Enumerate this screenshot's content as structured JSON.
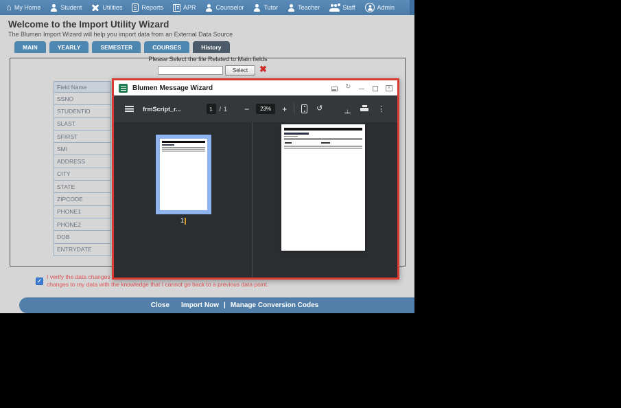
{
  "nav": {
    "items": [
      {
        "label": "My Home",
        "icon": "home-icon"
      },
      {
        "label": "Student",
        "icon": "student-icon"
      },
      {
        "label": "Utilities",
        "icon": "utilities-icon"
      },
      {
        "label": "Reports",
        "icon": "reports-icon"
      },
      {
        "label": "APR",
        "icon": "apr-icon"
      },
      {
        "label": "Counselor",
        "icon": "counselor-icon"
      },
      {
        "label": "Tutor",
        "icon": "tutor-icon"
      },
      {
        "label": "Teacher",
        "icon": "teacher-icon"
      },
      {
        "label": "Staff",
        "icon": "staff-icon"
      },
      {
        "label": "Admin",
        "icon": "admin-icon"
      }
    ]
  },
  "header": {
    "title": "Welcome to the Import Utility Wizard",
    "subtitle": "The Blumen Import Wizard will help you import data from an External Data Source"
  },
  "tabs": [
    {
      "label": "MAIN"
    },
    {
      "label": "YEARLY"
    },
    {
      "label": "SEMESTER"
    },
    {
      "label": "COURSES"
    },
    {
      "label": "History",
      "active": true
    }
  ],
  "file_select": {
    "prompt": "Please Select the file Related to Main fields",
    "input_value": "",
    "select_button": "Select",
    "clear_icon": "✖"
  },
  "field_table": {
    "header": "Field Name",
    "rows": [
      "SSNO",
      "STUDENTID",
      "SLAST",
      "SFIRST",
      "SMI",
      "ADDRESS",
      "CITY",
      "STATE",
      "ZIPCODE",
      "PHONE1",
      "PHONE2",
      "DOB",
      "ENTRYDATE"
    ]
  },
  "modal": {
    "title": "Blumen Message Wizard",
    "pdf_toolbar": {
      "doc_name": "frmScript_r...",
      "page_current": "1",
      "page_separator": "/",
      "page_total": "1",
      "zoom_minus": "−",
      "zoom_level": "23%",
      "zoom_plus": "+"
    },
    "thumbnail_page_label": "1"
  },
  "verify": {
    "checked": true,
    "checkmark": "✓",
    "line1": "I verify the data changes to",
    "line2": "changes to my data with the knowledge that I cannot go back to a previous data point."
  },
  "footer": {
    "close": "Close",
    "import_now": "Import Now",
    "divider": "|",
    "manage": "Manage Conversion Codes"
  },
  "colors": {
    "nav_blue": "#4f81ae",
    "tab_blue": "#4e86b2",
    "tab_active": "#4c5b69",
    "modal_border_red": "#dc3a31",
    "pdf_toolbar_dark": "#35383b",
    "pdf_content_dark": "#2b2e31",
    "thumbnail_selection": "#8fb3ee",
    "footer_blue": "#527fa9",
    "verify_red": "#e05252",
    "checkbox_blue": "#3f7ed4",
    "title_icon_green": "#1e7b4f"
  }
}
